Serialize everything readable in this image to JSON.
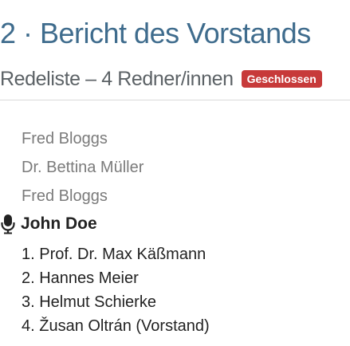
{
  "header": {
    "title": "2 · Bericht des Vorstands",
    "subtitle": "Redeliste – 4 Redner/innen",
    "status_badge": "Geschlossen"
  },
  "colors": {
    "title": "#3f6c8d",
    "badge_background": "#c73a3a",
    "past_speaker_text": "#7b7b7b",
    "current_speaker_text": "#222222"
  },
  "past_speakers": [
    {
      "name": "Fred Bloggs"
    },
    {
      "name": "Dr. Bettina Müller"
    },
    {
      "name": "Fred Bloggs"
    }
  ],
  "current_speaker": {
    "icon": "microphone-icon",
    "name": "John Doe"
  },
  "upcoming_speakers": [
    {
      "label": "1. Prof. Dr. Max Käßmann"
    },
    {
      "label": "2. Hannes Meier"
    },
    {
      "label": "3. Helmut Schierke"
    },
    {
      "label": "4. Žusan Oltrán (Vorstand)"
    }
  ]
}
